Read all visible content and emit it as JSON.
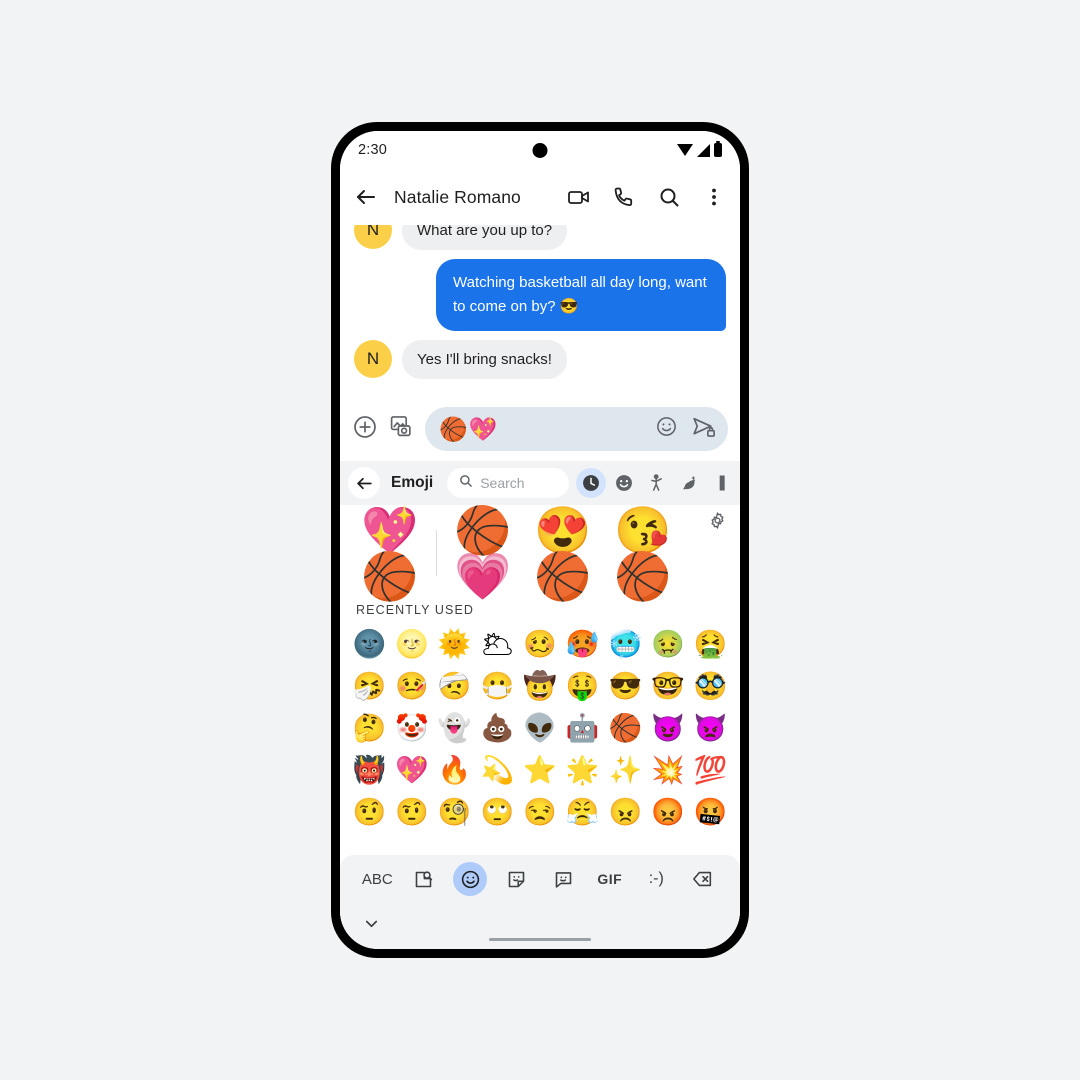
{
  "status_bar": {
    "time": "2:30",
    "icons": [
      "wifi-icon",
      "signal-icon",
      "battery-icon"
    ]
  },
  "app_bar": {
    "back_icon": "back-arrow-icon",
    "contact_name": "Natalie Romano",
    "actions": [
      "video-call-icon",
      "phone-call-icon",
      "search-icon",
      "overflow-menu-icon"
    ]
  },
  "conversation": {
    "messages": [
      {
        "direction": "incoming",
        "avatar_initial": "N",
        "text": "What are you up to?"
      },
      {
        "direction": "outgoing",
        "text": "Watching basketball all day long, want to come on by? 😎"
      },
      {
        "direction": "incoming",
        "avatar_initial": "N",
        "text": "Yes I'll bring snacks!"
      }
    ]
  },
  "compose_bar": {
    "add_icon": "plus-circle-icon",
    "gallery_icon": "gallery-camera-icon",
    "draft_text": "🏀💖",
    "emoji_icon": "emoji-smiley-icon",
    "send_icon": "send-encrypted-icon"
  },
  "emoji_panel": {
    "back_icon": "back-arrow-icon",
    "title": "Emoji",
    "search_icon": "search-icon",
    "search_placeholder": "Search",
    "categories": [
      {
        "name": "recent",
        "glyph": "🕐",
        "active": true
      },
      {
        "name": "smileys",
        "glyph": "😀",
        "active": false
      },
      {
        "name": "people",
        "glyph": "🕺",
        "active": false
      },
      {
        "name": "nature",
        "glyph": "🌿",
        "active": false
      },
      {
        "name": "food",
        "glyph": "🍔",
        "active": false
      }
    ],
    "settings_icon": "gear-icon",
    "sticker_suggestions": [
      "💖🏀",
      "🏀💗",
      "😍🏀",
      "😘🏀"
    ],
    "recently_used_label": "RECENTLY USED",
    "recently_used": [
      "🌚",
      "🌝",
      "🌞",
      "🌥",
      "🥴",
      "🥵",
      "🥶",
      "🤢",
      "🤮",
      "🤧",
      "🤒",
      "🤕",
      "😷",
      "🤠",
      "🤑",
      "😎",
      "🤓",
      "🥸",
      "🤔",
      "🤡",
      "👻",
      "💩",
      "👽",
      "🤖",
      "🏀",
      "😈",
      "👿",
      "👹",
      "💖",
      "🔥",
      "💫",
      "⭐",
      "🌟",
      "✨",
      "💥",
      "💯",
      "🤨",
      "🤨",
      "🧐",
      "🙄",
      "😒",
      "😤",
      "😠",
      "😡",
      "🤬"
    ]
  },
  "keyboard_bar": {
    "items": [
      {
        "name": "abc-key",
        "label": "ABC",
        "active": false
      },
      {
        "name": "sticker-search-icon",
        "label": "",
        "active": false
      },
      {
        "name": "emoji-icon",
        "label": "☺",
        "active": true
      },
      {
        "name": "sticker-icon",
        "label": "",
        "active": false
      },
      {
        "name": "emoticon-bubble-icon",
        "label": "",
        "active": false
      },
      {
        "name": "gif-key",
        "label": "GIF",
        "active": false
      },
      {
        "name": "emoticon-key",
        "label": ":-)",
        "active": false
      },
      {
        "name": "backspace-icon",
        "label": "",
        "active": false
      }
    ]
  },
  "nav_bar": {
    "hide_keyboard_icon": "chevron-down-icon",
    "home_indicator": "home-indicator"
  },
  "colors": {
    "outgoing_bubble": "#1a73e8",
    "incoming_bubble": "#eeeff1",
    "avatar": "#fbd048",
    "compose_field": "#dfe7ee",
    "active_highlight": "#d3e3fd",
    "keyboard_active": "#aecbfa",
    "page_background": "#f1f3f4"
  }
}
